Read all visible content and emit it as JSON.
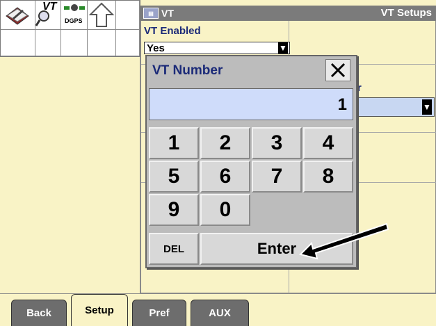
{
  "icons": {
    "tool": "wrench-book-icon",
    "vt": "vt-magnifier-icon",
    "vt_label": "VT",
    "dgps": "satellite-dgps-icon",
    "dgps_label": "DGPS",
    "up": "up-arrow-icon"
  },
  "header": {
    "chip_label": "VT",
    "title": "VT Setups"
  },
  "main": {
    "vt_enabled_label": "VT Enabled",
    "vt_enabled_value": "Yes",
    "partial_label": "r"
  },
  "dialog": {
    "title": "VT Number",
    "close_glyph": "×",
    "display_value": "1",
    "keys": [
      "1",
      "2",
      "3",
      "4",
      "5",
      "6",
      "7",
      "8",
      "9",
      "0"
    ],
    "del_label": "DEL",
    "enter_label": "Enter"
  },
  "tabs": {
    "back": "Back",
    "setup": "Setup",
    "pref": "Pref",
    "aux": "AUX"
  },
  "colors": {
    "background": "#f9f3c6",
    "header": "#7b7b7b",
    "display": "#cfdcfa",
    "accent_text": "#1b2a78"
  }
}
